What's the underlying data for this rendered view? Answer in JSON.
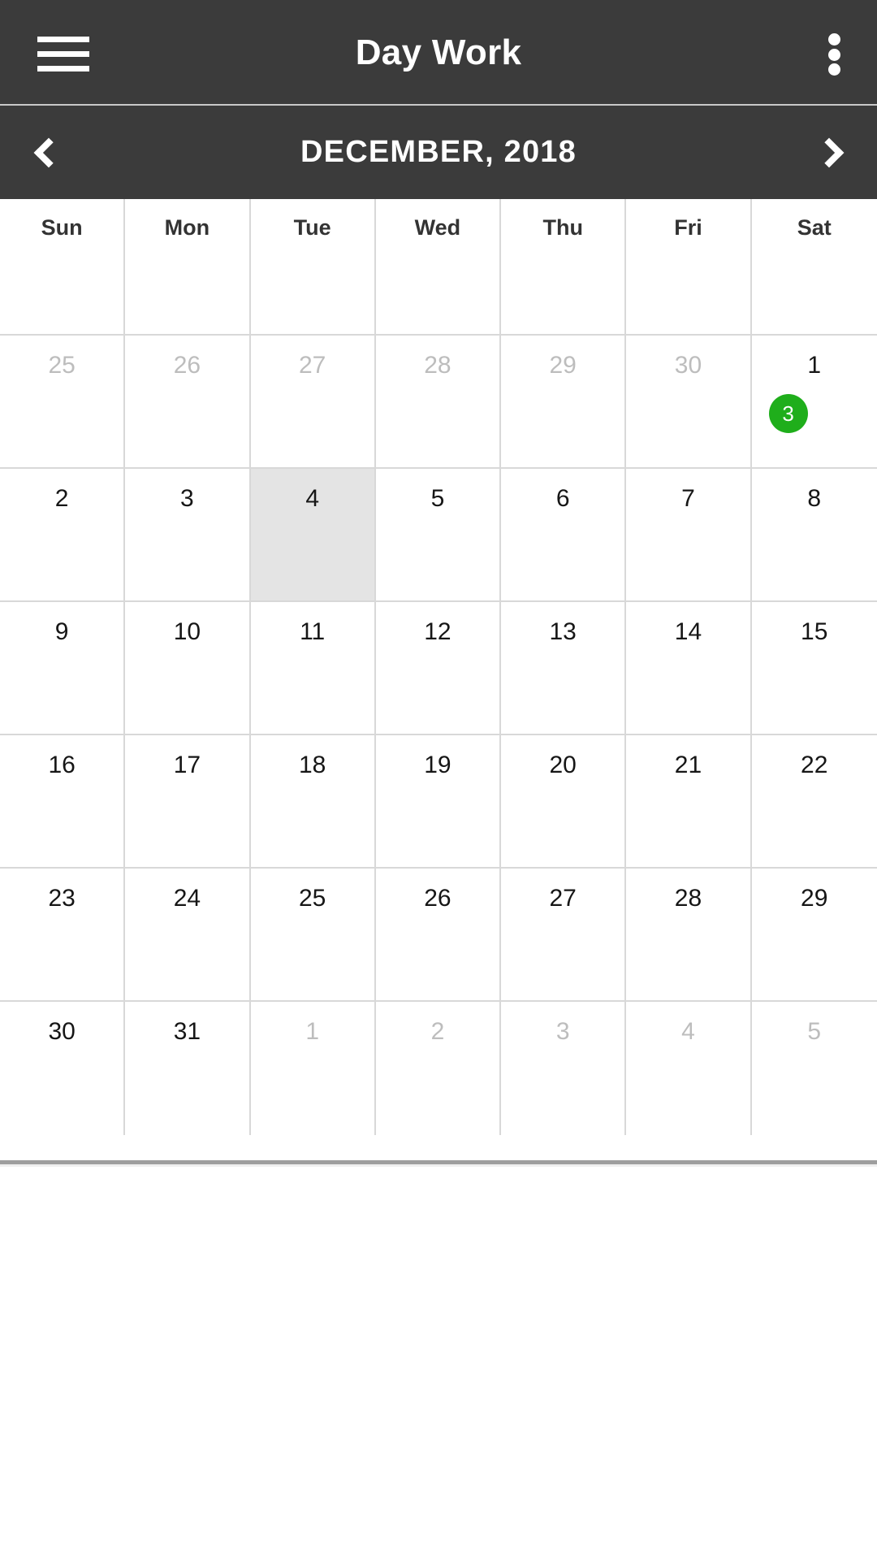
{
  "header": {
    "title": "Day Work",
    "menu_icon": "hamburger-icon",
    "overflow_icon": "more-vertical-icon",
    "background_color": "#3b3b3b"
  },
  "month_nav": {
    "label": "DECEMBER, 2018",
    "prev_icon": "chevron-left-icon",
    "next_icon": "chevron-right-icon"
  },
  "calendar": {
    "weekdays": [
      "Sun",
      "Mon",
      "Tue",
      "Wed",
      "Thu",
      "Fri",
      "Sat"
    ],
    "selected_date": "4",
    "accent_color": "#1fae1b",
    "selected_color": "#e4e4e4",
    "weeks": [
      [
        {
          "day": "25",
          "in_month": false
        },
        {
          "day": "26",
          "in_month": false
        },
        {
          "day": "27",
          "in_month": false
        },
        {
          "day": "28",
          "in_month": false
        },
        {
          "day": "29",
          "in_month": false
        },
        {
          "day": "30",
          "in_month": false
        },
        {
          "day": "1",
          "in_month": true,
          "badge": "3"
        }
      ],
      [
        {
          "day": "2",
          "in_month": true
        },
        {
          "day": "3",
          "in_month": true
        },
        {
          "day": "4",
          "in_month": true,
          "selected": true
        },
        {
          "day": "5",
          "in_month": true
        },
        {
          "day": "6",
          "in_month": true
        },
        {
          "day": "7",
          "in_month": true
        },
        {
          "day": "8",
          "in_month": true
        }
      ],
      [
        {
          "day": "9",
          "in_month": true
        },
        {
          "day": "10",
          "in_month": true
        },
        {
          "day": "11",
          "in_month": true
        },
        {
          "day": "12",
          "in_month": true
        },
        {
          "day": "13",
          "in_month": true
        },
        {
          "day": "14",
          "in_month": true
        },
        {
          "day": "15",
          "in_month": true
        }
      ],
      [
        {
          "day": "16",
          "in_month": true
        },
        {
          "day": "17",
          "in_month": true
        },
        {
          "day": "18",
          "in_month": true
        },
        {
          "day": "19",
          "in_month": true
        },
        {
          "day": "20",
          "in_month": true
        },
        {
          "day": "21",
          "in_month": true
        },
        {
          "day": "22",
          "in_month": true
        }
      ],
      [
        {
          "day": "23",
          "in_month": true
        },
        {
          "day": "24",
          "in_month": true
        },
        {
          "day": "25",
          "in_month": true
        },
        {
          "day": "26",
          "in_month": true
        },
        {
          "day": "27",
          "in_month": true
        },
        {
          "day": "28",
          "in_month": true
        },
        {
          "day": "29",
          "in_month": true
        }
      ],
      [
        {
          "day": "30",
          "in_month": true
        },
        {
          "day": "31",
          "in_month": true
        },
        {
          "day": "1",
          "in_month": false
        },
        {
          "day": "2",
          "in_month": false
        },
        {
          "day": "3",
          "in_month": false
        },
        {
          "day": "4",
          "in_month": false
        },
        {
          "day": "5",
          "in_month": false
        }
      ]
    ]
  }
}
